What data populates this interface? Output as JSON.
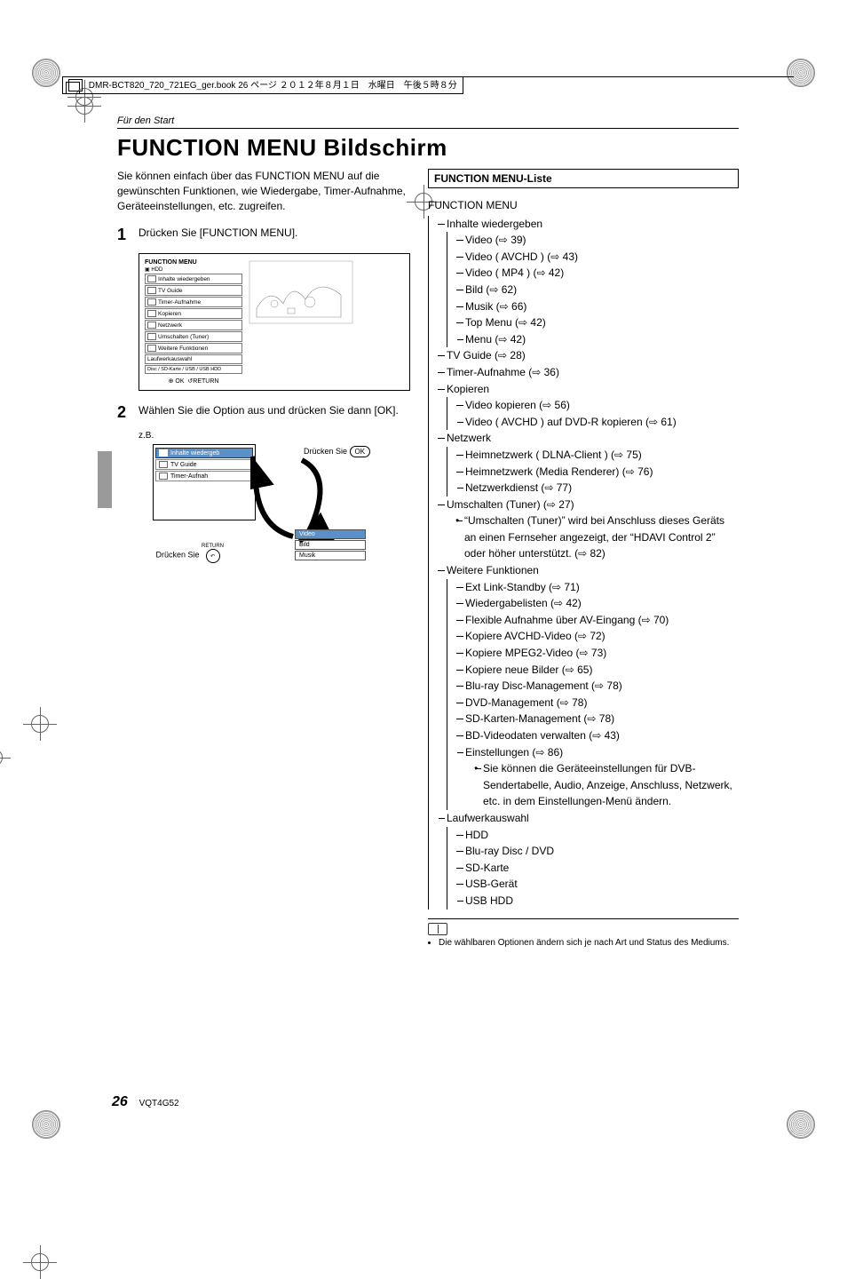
{
  "collate": {
    "text": "DMR-BCT820_720_721EG_ger.book  26 ページ  ２０１２年８月１日　水曜日　午後５時８分"
  },
  "section_label": "Für den Start",
  "title": "FUNCTION MENU Bildschirm",
  "intro": "Sie können einfach über das FUNCTION MENU auf die gewünschten Funktionen, wie Wiedergabe, Timer-Aufnahme, Geräteeinstellungen, etc. zugreifen.",
  "steps": {
    "s1_num": "1",
    "s1_text": "Drücken Sie [FUNCTION MENU].",
    "s2_num": "2",
    "s2_text": "Wählen Sie die Option aus und drücken Sie dann [OK].",
    "s2_eg": "z.B."
  },
  "diagram1": {
    "menu_title": "FUNCTION MENU",
    "sub_hdd": "HDD",
    "items": [
      "Inhalte wiedergeben",
      "TV Guide",
      "Timer-Aufnahme",
      "Kopieren",
      "Netzwerk",
      "Umschalten (Tuner)",
      "Weitere Funktionen",
      "Laufwerkauswahl"
    ],
    "drive_row": "Disc / SD-Karte / USB / USB HDD",
    "ok": "OK",
    "return": "RETURN"
  },
  "diagram2": {
    "press": "Drücken Sie",
    "ok": "OK",
    "return_label": "RETURN",
    "menu_items": [
      "Inhalte wiedergeb",
      "TV Guide",
      "Timer-Aufnah"
    ],
    "sub_items": [
      "Video",
      "Bild",
      "Musik"
    ]
  },
  "list": {
    "heading": "FUNCTION MENU-Liste",
    "root": "FUNCTION MENU",
    "inhalte": {
      "label": "Inhalte wiedergeben",
      "children": [
        "Video (⇨ 39)",
        "Video ( AVCHD ) (⇨ 43)",
        "Video ( MP4 ) (⇨ 42)",
        "Bild (⇨ 62)",
        "Musik (⇨ 66)",
        "Top Menu (⇨ 42)",
        "Menu (⇨ 42)"
      ]
    },
    "tvguide": "TV Guide (⇨ 28)",
    "timer": "Timer-Aufnahme (⇨ 36)",
    "kopieren": {
      "label": "Kopieren",
      "children": [
        "Video kopieren (⇨ 56)",
        "Video ( AVCHD ) auf DVD-R kopieren (⇨ 61)"
      ]
    },
    "netzwerk": {
      "label": "Netzwerk",
      "children": [
        "Heimnetzwerk ( DLNA-Client ) (⇨ 75)",
        "Heimnetzwerk (Media Renderer) (⇨ 76)",
        "Netzwerkdienst (⇨ 77)"
      ]
    },
    "umschalten": "Umschalten (Tuner) (⇨ 27)",
    "umschalten_note": "“Umschalten (Tuner)” wird bei Anschluss dieses Geräts an einen Fernseher angezeigt, der “HDAVI Control 2” oder höher unterstützt. (⇨ 82)",
    "weitere": {
      "label": "Weitere Funktionen",
      "children": [
        "Ext Link-Standby (⇨ 71)",
        "Wiedergabelisten (⇨ 42)",
        "Flexible Aufnahme über AV-Eingang (⇨ 70)",
        "Kopiere AVCHD-Video (⇨ 72)",
        "Kopiere MPEG2-Video (⇨ 73)",
        "Kopiere neue Bilder (⇨ 65)",
        "Blu-ray Disc-Management (⇨ 78)",
        "DVD-Management (⇨ 78)",
        "SD-Karten-Management (⇨ 78)",
        "BD-Videodaten verwalten (⇨ 43)",
        "Einstellungen (⇨ 86)"
      ],
      "note": "Sie können die Geräteeinstellungen für DVB-Sendertabelle, Audio, Anzeige, Anschluss, Netzwerk, etc. in dem Einstellungen-Menü ändern."
    },
    "laufwerk": {
      "label": "Laufwerkauswahl",
      "children": [
        "HDD",
        "Blu-ray Disc / DVD",
        "SD-Karte",
        "USB-Gerät",
        "USB HDD"
      ]
    }
  },
  "footnote": "Die wählbaren Optionen ändern sich je nach Art und Status des Mediums.",
  "footer": {
    "page": "26",
    "code": "VQT4G52"
  }
}
